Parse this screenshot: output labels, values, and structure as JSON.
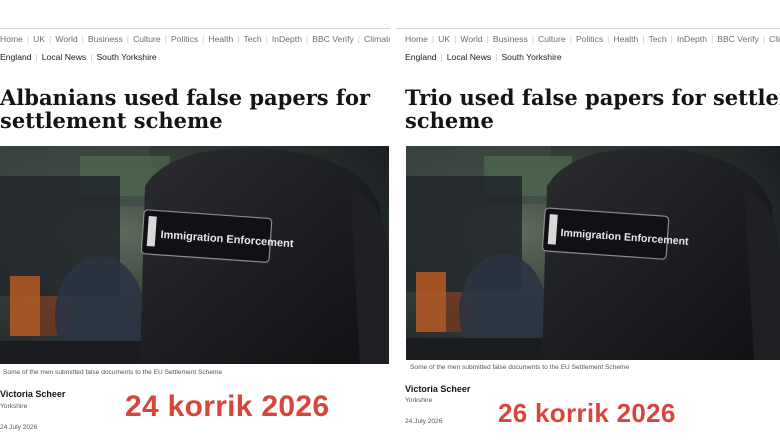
{
  "nav": [
    "Home",
    "UK",
    "World",
    "Business",
    "Culture",
    "Politics",
    "Health",
    "Tech",
    "InDepth",
    "BBC Verify",
    "Climate"
  ],
  "subnav": [
    "England",
    "Local News",
    "South Yorkshire"
  ],
  "patch_text": "Immigration Enforcement",
  "left": {
    "headline_line1": "Albanians used false papers for",
    "headline_line2": "settlement scheme",
    "caption": "Some of the men submitted false documents to the EU Settlement Scheme",
    "author": "Victoria Scheer",
    "region": "Yorkshire",
    "date": "24 July 2026",
    "overlay_date": "24 korrik 2026"
  },
  "right": {
    "headline_line1": "Trio used false papers for settlement",
    "headline_line2": "scheme",
    "caption": "Some of the men submitted false documents to the EU Settlement Scheme",
    "author": "Victoria Scheer",
    "region": "Yorkshire",
    "date": "24 July 2026",
    "overlay_date": "26 korrik 2026"
  },
  "colors": {
    "overlay_red": "#d8453a",
    "nav_gray": "#6e6e6e"
  }
}
